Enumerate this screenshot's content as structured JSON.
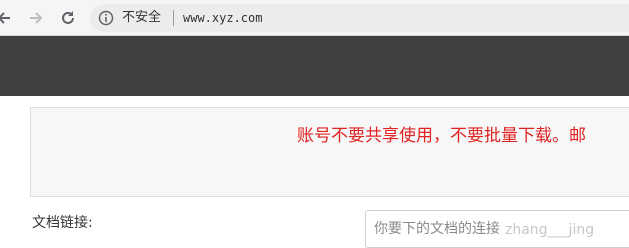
{
  "browser": {
    "security_label": "不安全",
    "url": "www.xyz.com"
  },
  "notice": {
    "text": "账号不要共享使用，不要批量下载。邮"
  },
  "form": {
    "doc_link_label": "文档链接:",
    "doc_link_placeholder": "你要下的文档的连接"
  },
  "watermark": {
    "text": "zhang___jing"
  },
  "colors": {
    "header_bg": "#404040",
    "notice_text": "#e02424",
    "toolbar_bg": "#f5f5f5"
  }
}
